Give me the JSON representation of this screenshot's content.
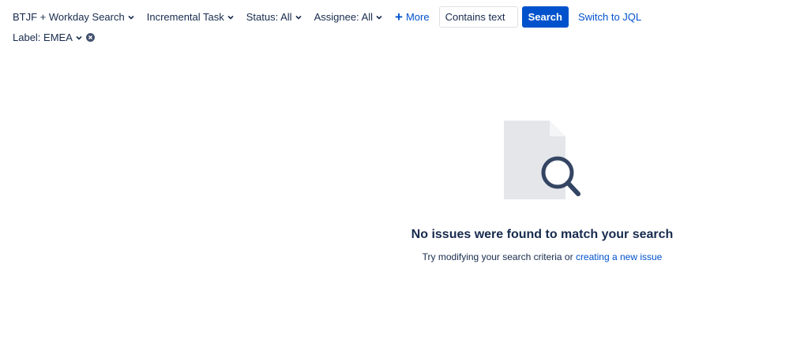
{
  "filters": {
    "project": "BTJF + Workday Search",
    "type": "Incremental Task",
    "status": "Status: All",
    "assignee": "Assignee: All",
    "more": "More",
    "text_placeholder": "Contains text",
    "search_button": "Search",
    "switch_jql": "Switch to JQL",
    "label": "Label: EMEA"
  },
  "empty_state": {
    "title": "No issues were found to match your search",
    "subtitle_prefix": "Try modifying your search criteria or ",
    "create_link": "creating a new issue"
  },
  "icons": {
    "chevron": "chevron-down-icon",
    "plus": "plus-icon",
    "clear": "clear-circle-icon",
    "empty": "document-search-illustration"
  },
  "colors": {
    "text": "#172b4d",
    "link": "#0052cc",
    "primary_button": "#0052cc",
    "illustration_page": "#e4e6ea",
    "illustration_glass": "#344563"
  }
}
